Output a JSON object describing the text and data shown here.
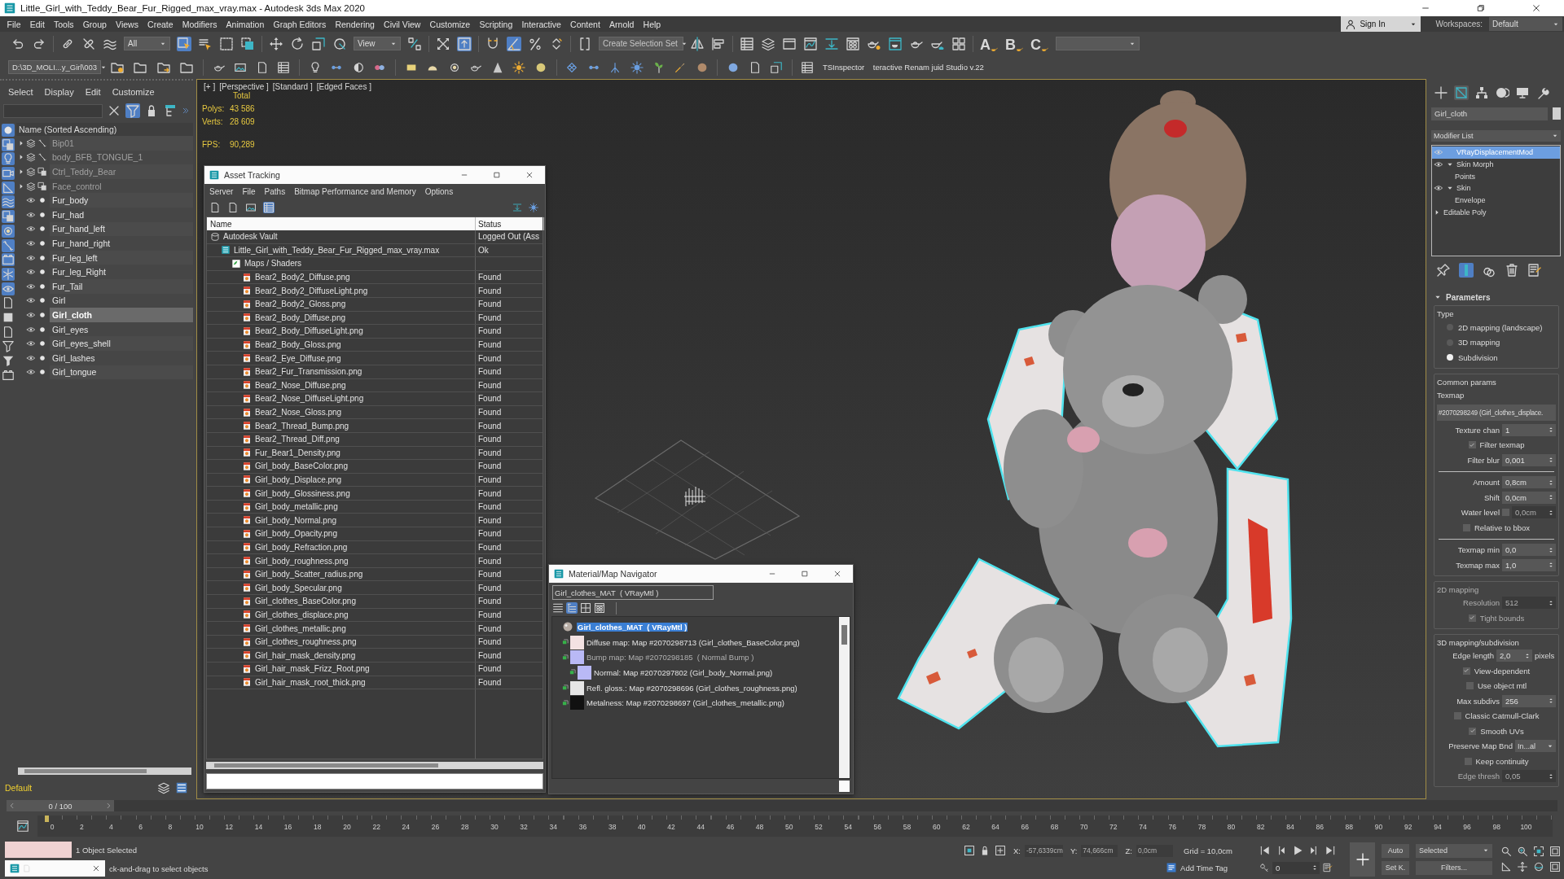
{
  "window": {
    "title": "Little_Girl_with_Teddy_Bear_Fur_Rigged_max_vray.max - Autodesk 3ds Max 2020"
  },
  "menu": [
    "File",
    "Edit",
    "Tools",
    "Group",
    "Views",
    "Create",
    "Modifiers",
    "Animation",
    "Graph Editors",
    "Rendering",
    "Civil View",
    "Customize",
    "Scripting",
    "Interactive",
    "Content",
    "Arnold",
    "Help"
  ],
  "account": {
    "sign_in": "Sign In",
    "workspaces_label": "Workspaces:",
    "workspace": "Default"
  },
  "main_toolbar": {
    "selection_filter": "All",
    "reference_coordinate": "View",
    "selection_set": {
      "placeholder": "Create Selection Set"
    },
    "buttons": [
      {
        "on": false
      },
      {
        "on": false
      },
      {
        "on": false
      },
      {
        "on": false
      },
      {
        "on": false
      },
      {
        "on": true
      },
      {
        "on": false
      },
      {
        "on": false
      },
      {
        "on": false
      },
      {
        "on": false
      },
      {
        "on": false
      },
      {
        "on": false
      },
      {
        "on": false
      },
      {
        "on": false
      },
      {
        "on": false
      },
      {
        "on": true
      },
      {
        "on": false
      },
      {
        "on": true
      },
      {
        "on": false
      },
      {
        "on": false
      },
      {
        "on": false
      },
      {
        "on": false
      },
      {
        "on": false
      },
      {
        "on": false
      },
      {
        "on": false
      },
      {
        "on": false
      },
      {
        "on": false
      },
      {
        "on": false
      },
      {
        "on": false
      },
      {
        "on": false
      },
      {
        "on": false
      },
      {
        "on": false
      },
      {
        "on": false
      },
      {
        "on": false
      }
    ],
    "script_buttons": [
      "A",
      "B",
      "C"
    ]
  },
  "secondary_toolbar": {
    "project_path": "D:\\3D_MOLI...y_Girl\\003",
    "tools": [
      "TSInspector",
      "teractive Renam juid Studio v.22"
    ]
  },
  "scene_explorer": {
    "menu": [
      "Select",
      "Display",
      "Edit",
      "Customize"
    ],
    "tools": [
      {
        "on": false
      },
      {
        "on": true
      },
      {
        "on": false
      },
      {
        "on": false
      }
    ],
    "filters": [
      {
        "on": true
      },
      {
        "on": true
      },
      {
        "on": true
      },
      {
        "on": true
      },
      {
        "on": true
      },
      {
        "on": true
      },
      {
        "on": true
      },
      {
        "on": true
      },
      {
        "on": true
      },
      {
        "on": true
      },
      {
        "on": true
      },
      {
        "on": true
      },
      {
        "on": false
      },
      {
        "on": false
      },
      {
        "on": false
      },
      {
        "on": false
      },
      {
        "on": false
      },
      {
        "on": false
      }
    ],
    "header": "Name (Sorted Ascending)",
    "rows": [
      {
        "name": "Bip01",
        "kind": "bone",
        "hidden": true,
        "expanded": false,
        "selected": false
      },
      {
        "name": "body_BFB_TONGUE_1",
        "kind": "bone",
        "hidden": true,
        "expanded": false,
        "selected": false
      },
      {
        "name": "Ctrl_Teddy_Bear",
        "kind": "helper",
        "hidden": true,
        "expanded": false,
        "selected": false
      },
      {
        "name": "Face_control",
        "kind": "helper",
        "hidden": true,
        "expanded": false,
        "selected": false
      },
      {
        "name": "Fur_body",
        "kind": "object",
        "hidden": false,
        "selected": false
      },
      {
        "name": "Fur_had",
        "kind": "object",
        "hidden": false,
        "selected": false
      },
      {
        "name": "Fur_hand_left",
        "kind": "object",
        "hidden": false,
        "selected": false
      },
      {
        "name": "Fur_hand_right",
        "kind": "object",
        "hidden": false,
        "selected": false
      },
      {
        "name": "Fur_leg_left",
        "kind": "object",
        "hidden": false,
        "selected": false
      },
      {
        "name": "Fur_leg_Right",
        "kind": "object",
        "hidden": false,
        "selected": false
      },
      {
        "name": "Fur_Tail",
        "kind": "object",
        "hidden": false,
        "selected": false
      },
      {
        "name": "Girl",
        "kind": "object",
        "hidden": false,
        "selected": false
      },
      {
        "name": "Girl_cloth",
        "kind": "object",
        "hidden": false,
        "selected": true
      },
      {
        "name": "Girl_eyes",
        "kind": "object",
        "hidden": false,
        "selected": false
      },
      {
        "name": "Girl_eyes_shell",
        "kind": "object",
        "hidden": false,
        "selected": false
      },
      {
        "name": "Girl_lashes",
        "kind": "object",
        "hidden": false,
        "selected": false
      },
      {
        "name": "Girl_tongue",
        "kind": "object",
        "hidden": false,
        "selected": false
      }
    ],
    "layer": "Default"
  },
  "viewport": {
    "labels": [
      "[+ ]",
      "[Perspective ]",
      "[Standard ]",
      "[Edged Faces ]"
    ],
    "stats": {
      "heading": "Total",
      "rows": [
        {
          "label": "Polys:",
          "value": "43 586"
        },
        {
          "label": "Verts:",
          "value": "28 609"
        },
        {
          "label": "FPS:",
          "value": "90,289"
        }
      ]
    }
  },
  "asset_tracking": {
    "title": "Asset Tracking",
    "menu": [
      "Server",
      "File",
      "Paths",
      "Bitmap Performance and Memory",
      "Options"
    ],
    "toolbar": [
      {
        "on": false
      },
      {
        "on": false
      },
      {
        "on": false
      },
      {
        "on": true
      }
    ],
    "columns": [
      "Name",
      "Status"
    ],
    "rows": [
      {
        "name": "Autodesk Vault",
        "status": "Logged Out (Ass",
        "kind": "vault",
        "children": [
          {
            "name": "Little_Girl_with_Teddy_Bear_Fur_Rigged_max_vray.max",
            "status": "Ok",
            "kind": "scene",
            "children": [
              {
                "name": "Maps / Shaders",
                "kind": "folder",
                "children": [
                  {
                    "name": "Bear2_Body2_Diffuse.png",
                    "status": "Found",
                    "kind": "bitmap"
                  },
                  {
                    "name": "Bear2_Body2_DiffuseLight.png",
                    "status": "Found",
                    "kind": "bitmap"
                  },
                  {
                    "name": "Bear2_Body2_Gloss.png",
                    "status": "Found",
                    "kind": "bitmap"
                  },
                  {
                    "name": "Bear2_Body_Diffuse.png",
                    "status": "Found",
                    "kind": "bitmap"
                  },
                  {
                    "name": "Bear2_Body_DiffuseLight.png",
                    "status": "Found",
                    "kind": "bitmap"
                  },
                  {
                    "name": "Bear2_Body_Gloss.png",
                    "status": "Found",
                    "kind": "bitmap"
                  },
                  {
                    "name": "Bear2_Eye_Diffuse.png",
                    "status": "Found",
                    "kind": "bitmap"
                  },
                  {
                    "name": "Bear2_Fur_Transmission.png",
                    "status": "Found",
                    "kind": "bitmap"
                  },
                  {
                    "name": "Bear2_Nose_Diffuse.png",
                    "status": "Found",
                    "kind": "bitmap"
                  },
                  {
                    "name": "Bear2_Nose_DiffuseLight.png",
                    "status": "Found",
                    "kind": "bitmap"
                  },
                  {
                    "name": "Bear2_Nose_Gloss.png",
                    "status": "Found",
                    "kind": "bitmap"
                  },
                  {
                    "name": "Bear2_Thread_Bump.png",
                    "status": "Found",
                    "kind": "bitmap"
                  },
                  {
                    "name": "Bear2_Thread_Diff.png",
                    "status": "Found",
                    "kind": "bitmap"
                  },
                  {
                    "name": "Fur_Bear1_Density.png",
                    "status": "Found",
                    "kind": "bitmap"
                  },
                  {
                    "name": "Girl_body_BaseColor.png",
                    "status": "Found",
                    "kind": "bitmap"
                  },
                  {
                    "name": "Girl_body_Displace.png",
                    "status": "Found",
                    "kind": "bitmap"
                  },
                  {
                    "name": "Girl_body_Glossiness.png",
                    "status": "Found",
                    "kind": "bitmap"
                  },
                  {
                    "name": "Girl_body_metallic.png",
                    "status": "Found",
                    "kind": "bitmap"
                  },
                  {
                    "name": "Girl_body_Normal.png",
                    "status": "Found",
                    "kind": "bitmap"
                  },
                  {
                    "name": "Girl_body_Opacity.png",
                    "status": "Found",
                    "kind": "bitmap"
                  },
                  {
                    "name": "Girl_body_Refraction.png",
                    "status": "Found",
                    "kind": "bitmap"
                  },
                  {
                    "name": "Girl_body_roughness.png",
                    "status": "Found",
                    "kind": "bitmap"
                  },
                  {
                    "name": "Girl_body_Scatter_radius.png",
                    "status": "Found",
                    "kind": "bitmap"
                  },
                  {
                    "name": "Girl_body_Specular.png",
                    "status": "Found",
                    "kind": "bitmap"
                  },
                  {
                    "name": "Girl_clothes_BaseColor.png",
                    "status": "Found",
                    "kind": "bitmap"
                  },
                  {
                    "name": "Girl_clothes_displace.png",
                    "status": "Found",
                    "kind": "bitmap"
                  },
                  {
                    "name": "Girl_clothes_metallic.png",
                    "status": "Found",
                    "kind": "bitmap"
                  },
                  {
                    "name": "Girl_clothes_roughness.png",
                    "status": "Found",
                    "kind": "bitmap"
                  },
                  {
                    "name": "Girl_hair_mask_density.png",
                    "status": "Found",
                    "kind": "bitmap"
                  },
                  {
                    "name": "Girl_hair_mask_Frizz_Root.png",
                    "status": "Found",
                    "kind": "bitmap"
                  },
                  {
                    "name": "Girl_hair_mask_root_thick.png",
                    "status": "Found",
                    "kind": "bitmap"
                  }
                ]
              }
            ]
          }
        ]
      }
    ]
  },
  "material_navigator": {
    "title": "Material/Map Navigator",
    "material_field": "Girl_clothes_MAT  ( VRayMtl )",
    "view_buttons": [
      {
        "selected": false
      },
      {
        "selected": true
      },
      {
        "selected": false
      },
      {
        "selected": false
      }
    ],
    "tree": {
      "label": "Girl_clothes_MAT  ( VRayMtl )",
      "selected": true,
      "children": [
        {
          "label": "Diffuse map: Map #2070298713 (Girl_clothes_BaseColor.png)",
          "color": "#f3e2e2",
          "selected": false,
          "disabled": false
        },
        {
          "label": "Bump map: Map #2070298185  ( Normal Bump )",
          "color": "#b9b9f6",
          "selected": false,
          "disabled": true,
          "children": [
            {
              "label": "Normal: Map #2070297802 (Girl_body_Normal.png)",
              "color": "#b9b9f6",
              "selected": false,
              "disabled": false
            }
          ]
        },
        {
          "label": "Refl. gloss.: Map #2070298696 (Girl_clothes_roughness.png)",
          "color": "#e6e6e6",
          "selected": false,
          "disabled": false
        },
        {
          "label": "Metalness: Map #2070298697 (Girl_clothes_metallic.png)",
          "color": "#111111",
          "selected": false,
          "disabled": false
        }
      ]
    }
  },
  "command_panel": {
    "tabs": [
      {
        "selected": false
      },
      {
        "selected": true
      },
      {
        "selected": false
      },
      {
        "selected": false
      },
      {
        "selected": false
      },
      {
        "selected": false
      }
    ],
    "object_name": "Girl_cloth",
    "modifier_list": "Modifier List",
    "stack": [
      {
        "label": "VRayDisplacementMod",
        "kind": "modifier",
        "enabled": true,
        "selected": true
      },
      {
        "label": "Skin Morph",
        "kind": "modifier",
        "enabled": true,
        "expanded": true,
        "selected": false,
        "children": [
          {
            "label": "Points",
            "selected": false
          }
        ]
      },
      {
        "label": "Skin",
        "kind": "modifier",
        "enabled": true,
        "expanded": true,
        "selected": false,
        "children": [
          {
            "label": "Envelope",
            "selected": false
          }
        ]
      },
      {
        "label": "Editable Poly",
        "kind": "base",
        "expanded": false,
        "selected": false
      }
    ],
    "stack_tools": [
      {
        "on": false
      },
      {
        "on": true
      },
      {
        "on": false
      },
      {
        "on": false
      },
      {
        "on": false
      }
    ],
    "rollout": {
      "title": "Parameters",
      "expanded": true,
      "groups": [
        {
          "title": "Type",
          "disabled": false,
          "rows": [
            {
              "kind": "radio",
              "label": "2D mapping (landscape)",
              "selected": false
            },
            {
              "kind": "radio",
              "label": "3D mapping",
              "selected": false
            },
            {
              "kind": "radio",
              "label": "Subdivision",
              "selected": true
            }
          ]
        },
        {
          "title": "Common params",
          "disabled": false,
          "rows": [
            {
              "kind": "label",
              "label": "Texmap"
            },
            {
              "kind": "map_button",
              "value": "#2070298249 (Girl_clothes_displace."
            },
            {
              "kind": "spinner",
              "label": "Texture chan",
              "value": "1",
              "disabled": false
            },
            {
              "kind": "checkbox",
              "label": "Filter texmap",
              "checked": true,
              "disabled": false
            },
            {
              "kind": "spinner",
              "label": "Filter blur",
              "value": "0,001",
              "disabled": false
            },
            {
              "kind": "divider"
            },
            {
              "kind": "spinner",
              "label": "Amount",
              "value": "0,8cm",
              "disabled": false
            },
            {
              "kind": "spinner",
              "label": "Shift",
              "value": "0,0cm",
              "disabled": false
            },
            {
              "kind": "check_spinner",
              "label": "Water level",
              "checked": false,
              "value": "0,0cm",
              "disabled": true
            },
            {
              "kind": "checkbox",
              "label": "Relative to bbox",
              "checked": false,
              "disabled": false
            },
            {
              "kind": "divider"
            },
            {
              "kind": "spinner",
              "label": "Texmap min",
              "value": "0,0",
              "disabled": false
            },
            {
              "kind": "spinner",
              "label": "Texmap max",
              "value": "1,0",
              "disabled": false
            }
          ]
        },
        {
          "title": "2D mapping",
          "disabled": true,
          "rows": [
            {
              "kind": "spinner",
              "label": "Resolution",
              "value": "512",
              "disabled": true
            },
            {
              "kind": "checkbox",
              "label": "Tight bounds",
              "checked": true,
              "disabled": true
            }
          ]
        },
        {
          "title": "3D mapping/subdivision",
          "disabled": false,
          "rows": [
            {
              "kind": "spinner",
              "label": "Edge length",
              "value": "2,0",
              "unit": "pixels",
              "disabled": false
            },
            {
              "kind": "checkbox",
              "label": "View-dependent",
              "checked": true,
              "disabled": false
            },
            {
              "kind": "checkbox",
              "label": "Use object mtl",
              "checked": false,
              "disabled": false
            },
            {
              "kind": "spinner",
              "label": "Max subdivs",
              "value": "256",
              "disabled": false
            },
            {
              "kind": "checkbox",
              "label": "Classic Catmull-Clark",
              "checked": false,
              "disabled": false
            },
            {
              "kind": "checkbox",
              "label": "Smooth UVs",
              "checked": true,
              "disabled": false
            },
            {
              "kind": "dropdown",
              "label": "Preserve Map Bnd",
              "value": "In...al",
              "disabled": false
            },
            {
              "kind": "checkbox",
              "label": "Keep continuity",
              "checked": false,
              "disabled": false
            },
            {
              "kind": "spinner",
              "label": "Edge thresh",
              "value": "0,05",
              "disabled": true
            }
          ]
        }
      ]
    }
  },
  "time_slider": {
    "position": "0 / 100",
    "level": 0
  },
  "timeline": {
    "ticks": [
      "0",
      "2",
      "4",
      "6",
      "8",
      "10",
      "12",
      "14",
      "16",
      "18",
      "20",
      "22",
      "24",
      "26",
      "28",
      "30",
      "32",
      "34",
      "36",
      "38",
      "40",
      "42",
      "44",
      "46",
      "48",
      "50",
      "52",
      "54",
      "56",
      "58",
      "60",
      "62",
      "64",
      "66",
      "68",
      "70",
      "72",
      "74",
      "76",
      "78",
      "80",
      "82",
      "84",
      "86",
      "88",
      "90",
      "92",
      "94",
      "96",
      "98",
      "100"
    ]
  },
  "status_bar": {
    "selection": "1 Object Selected",
    "prompt": "ck-and-drag to select objects",
    "coordinates": [
      {
        "label": "X:",
        "value": "-57,6339cm"
      },
      {
        "label": "Y:",
        "value": "74,666cm"
      },
      {
        "label": "Z:",
        "value": "0,0cm"
      }
    ],
    "grid": "Grid = 10,0cm",
    "time_tag": "Add Time Tag",
    "frame": "0",
    "auto_key": "Auto",
    "set_key": "Set K.",
    "key_filter": "Selected",
    "filters": "Filters..."
  }
}
